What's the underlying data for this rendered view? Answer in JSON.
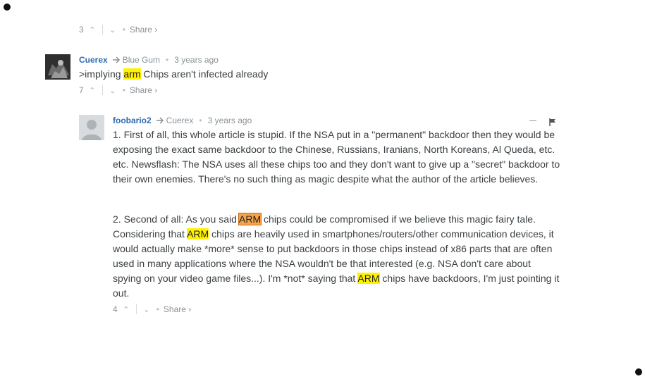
{
  "top_comment_footer": {
    "count": "3",
    "share": "Share ›"
  },
  "comment1": {
    "author": "Cuerex",
    "reply_to": "Blue Gum",
    "time": "3 years ago",
    "text_before": ">implying ",
    "highlight": "arm",
    "text_after": " Chips aren't infected already",
    "count": "7",
    "share": "Share ›"
  },
  "comment2": {
    "author": "foobario2",
    "reply_to": "Cuerex",
    "time": "3 years ago",
    "para1": "1. First of all, this whole article is stupid. If the NSA put in a \"permanent\" backdoor then they would be exposing the exact same backdoor to the Chinese, Russians, Iranians, North Koreans, Al Queda, etc. etc. Newsflash: The NSA uses all these chips too and they don't want to give up a \"secret\" backdoor to their own enemies. There's no such thing as magic despite what the author of the article believes.",
    "p2_a": "2. Second of all: As you said ",
    "p2_hl1": "ARM",
    "p2_b": " chips could be compromised if we believe this magic fairy tale. Considering that ",
    "p2_hl2": "ARM",
    "p2_c": " chips are heavily used in smartphones/routers/other communication devices, it would actually make *more* sense to put backdoors in those chips instead of x86 parts that are often used in many applications where the NSA wouldn't be that interested (e.g. NSA don't care about spying on your video game files...). I'm *not* saying that ",
    "p2_hl3": "ARM",
    "p2_d": " chips have backdoors, I'm just pointing it out.",
    "count": "4",
    "share": "Share ›"
  },
  "icons": [
    "upvote-icon",
    "downvote-icon",
    "reply-arrow-icon",
    "flag-icon",
    "collapse-icon"
  ],
  "colors": {
    "author": "#2e6ab4",
    "meta": "#8a9196",
    "highlight_yellow": "#fff200",
    "highlight_orange": "#f7a34a"
  }
}
